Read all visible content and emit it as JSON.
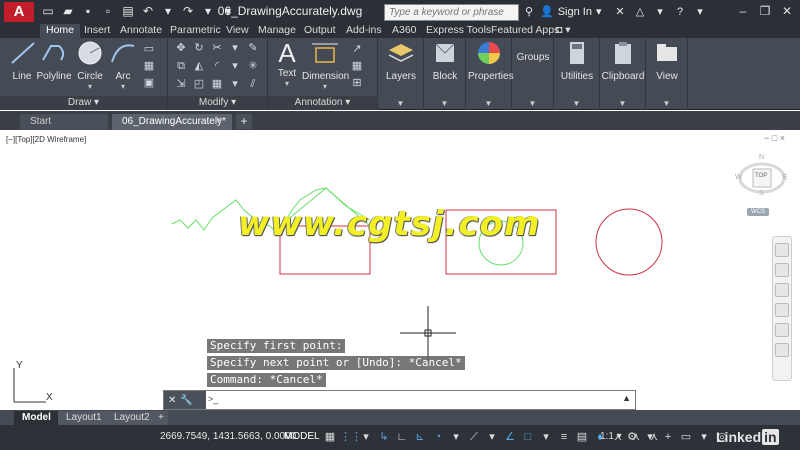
{
  "titlebar": {
    "logo": "A",
    "document_title": "06_DrawingAccurately.dwg",
    "search_placeholder": "Type a keyword or phrase",
    "signin_label": "Sign In",
    "help_label": "?"
  },
  "ribbon_tabs": [
    "Home",
    "Insert",
    "Annotate",
    "Parametric",
    "View",
    "Manage",
    "Output",
    "Add-ins",
    "A360",
    "Express Tools",
    "Featured Apps"
  ],
  "ribbon": {
    "draw_tools": [
      "Line",
      "Polyline",
      "Circle",
      "Arc"
    ],
    "draw_panel_label": "Draw",
    "modify_panel_label": "Modify",
    "annotation_tools": [
      "Text",
      "Dimension"
    ],
    "annotation_panel_label": "Annotation",
    "single_tools": [
      "Layers",
      "Block",
      "Properties",
      "Groups",
      "Utilities",
      "Clipboard",
      "View"
    ]
  },
  "file_tabs": {
    "start": "Start",
    "document": "06_DrawingAccurately*",
    "close": "×",
    "add": "+"
  },
  "viewport": {
    "label": "[−][Top][2D Wireframe]",
    "controls": "− □ ×"
  },
  "viewcube": {
    "face": "TOP",
    "north": "N",
    "south": "S",
    "east": "E",
    "west": "W",
    "wcs": "WCS"
  },
  "watermark": "www.cgtsj.com",
  "command_history": [
    "Specify first point:",
    "Specify next point or [Undo]: *Cancel*",
    "Command: *Cancel*"
  ],
  "command_line": {
    "prompt_icon": ">_",
    "value": ""
  },
  "ucs": {
    "x": "X",
    "y": "Y"
  },
  "layout_tabs": [
    "Model",
    "Layout1",
    "Layout2"
  ],
  "status_bar": {
    "coordinates": "2669.7549, 1431.5663, 0.0000",
    "model": "MODEL",
    "scale": "1:1"
  },
  "brand": {
    "text": "Linked",
    "badge": "in"
  },
  "colors": {
    "accent_red": "#c31c2a",
    "drawing_green": "#66e066",
    "drawing_red": "#cc3344",
    "watermark_yellow": "#f2ef25"
  }
}
